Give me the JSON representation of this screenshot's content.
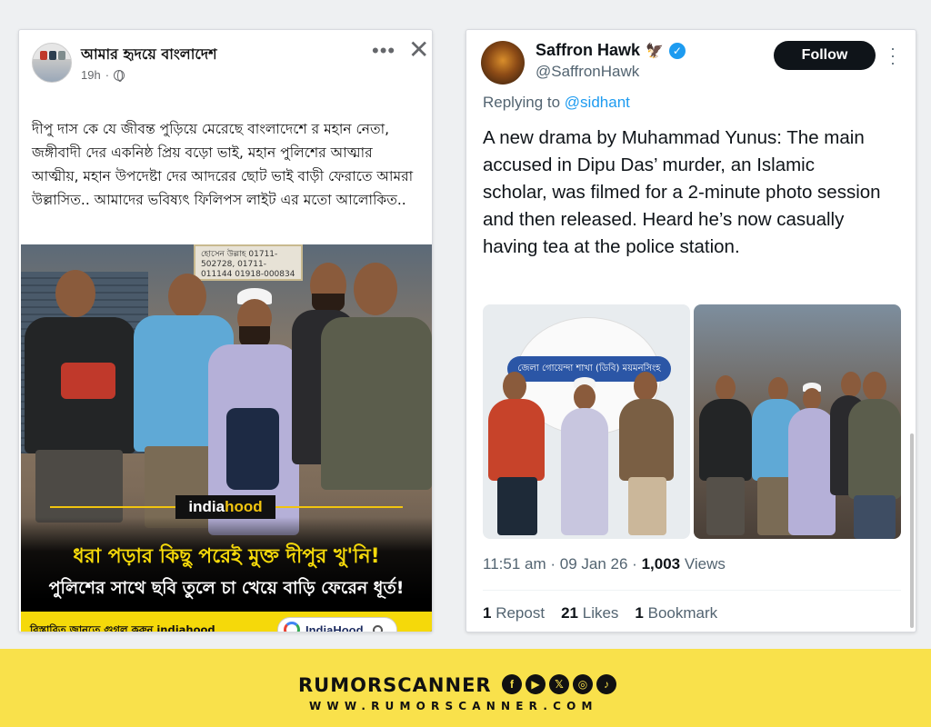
{
  "facebook_post": {
    "page_name": "আমার হৃদয়ে বাংলাদেশ",
    "time": "19h",
    "text": "দীপু দাস কে যে জীবন্ত পুড়িয়ে মেরেছে বাংলাদেশে র মহান নেতা, জঙ্গীবাদী দের একনিষ্ঠ প্রিয় বড়ো ভাই, মহান পুলিশের আত্মার আত্মীয়, মহান উপদেষ্টা দের আদরের ছোট ভাই বাড়ী ফেরাতে আমরা উল্লাসিত.. আমাদের ভবিষ্যৎ ফিলিপস লাইট এর মতো আলোকিত..",
    "more_icon": "•••",
    "close_icon": "✕",
    "image": {
      "brand_prefix": "india",
      "brand_suffix": "hood",
      "headline_1": "ধরা পড়ার কিছু পরেই মুক্ত দীপুর খু'নি!",
      "headline_2": "পুলিশের সাথে ছবি তুলে চা খেয়ে বাড়ি ফেরেন ধূর্ত!",
      "footer_note": "বিস্তারিত জানতে গুগল করুন indiahood",
      "search_label": "IndiaHood",
      "shop_sign": "হোসেন উল্লাহ 01711-502728, 01711-011144 01918-000834"
    }
  },
  "tweet": {
    "display_name": "Saffron Hawk",
    "handle": "@SaffronHawk",
    "follow_label": "Follow",
    "replying_prefix": "Replying to",
    "replying_to": "@sidhant",
    "text": "A new drama by Muhammad Yunus: The main accused in Dipu Das’ murder, an Islamic scholar, was filmed for a 2-minute photo session and then released. Heard he’s now casually having tea at the police station.",
    "photo_banner": "জেলা গোয়েন্দা শাখা (ডিবি) ময়মনসিংহ",
    "time": "11:51 am",
    "date": "09 Jan 26",
    "views_count": "1,003",
    "views_label": "Views",
    "reposts_count": "1",
    "reposts_label": "Repost",
    "likes_count": "21",
    "likes_label": "Likes",
    "bookmarks_count": "1",
    "bookmarks_label": "Bookmark"
  },
  "footer": {
    "brand": "RUMORSCANNER",
    "url": "WWW.RUMORSCANNER.COM",
    "social": [
      "f",
      "▶",
      "𝕏",
      "◎",
      "♪"
    ]
  },
  "colors": {
    "twitter_blue": "#1d9bf0",
    "banner_yellow": "#f9e14b",
    "headline_yellow": "#f5d90a"
  }
}
